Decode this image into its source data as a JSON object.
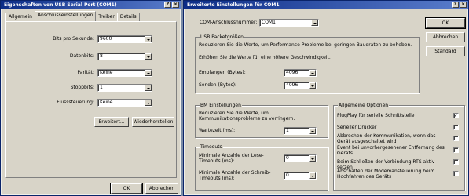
{
  "left_window": {
    "title": "Eigenschaften von USB Serial Port (COM1)",
    "tabs": [
      "Allgemein",
      "Anschlusseinstellungen",
      "Treiber",
      "Details"
    ],
    "fields": [
      {
        "label": "Bits pro Sekunde:",
        "value": "9600"
      },
      {
        "label": "Datenbits:",
        "value": "8"
      },
      {
        "label": "Parität:",
        "value": "Keine"
      },
      {
        "label": "Stoppbits:",
        "value": "1"
      },
      {
        "label": "Flusssteuerung:",
        "value": "Keine"
      }
    ],
    "advanced_button": "Erweitert...",
    "restore_button": "Wiederherstellen",
    "ok_button": "OK",
    "cancel_button": "Abbrechen"
  },
  "right_window": {
    "title": "Erweiterte Einstellungen für COM1",
    "com_label": "COM-Anschlussnummer:",
    "com_value": "COM1",
    "ok_button": "OK",
    "cancel_button": "Abbrechen",
    "standard_button": "Standard",
    "usb_group": {
      "title": "USB Packetgrößen",
      "desc1": "Reduzieren Sie die Werte, um Performance-Probleme bei geringen Baudraten zu beheben.",
      "desc2": "Erhöhen Sie die Werte für eine höhere Geschwindigkeit.",
      "receive_label": "Empfangen (Bytes):",
      "receive_value": "4096",
      "send_label": "Senden (Bytes):",
      "send_value": "4096"
    },
    "bm_group": {
      "title": "BM Einstellungen",
      "desc": "Reduzieren Sie die Werte, um Kommunikationsprobleme zu verringern.",
      "latency_label": "Wartezeit (ms):",
      "latency_value": "1"
    },
    "timeouts_group": {
      "title": "Timeouts",
      "read_label": "Minimale Anzahle der Lese-Timeouts (ms):",
      "read_value": "0",
      "write_label": "Minimale Anzahle der Schreib-Timeouts (ms):",
      "write_value": "0"
    },
    "options_group": {
      "title": "Allgemeine Optionen",
      "items": [
        {
          "label": "PlugPlay für serielle Schnittstelle",
          "checked": "✓"
        },
        {
          "label": "Serieller Drucker",
          "checked": ""
        },
        {
          "label": "Abbrechen der Kommunikation, wenn das Gerät ausgeschaltet wird",
          "checked": ""
        },
        {
          "label": "Event bei unvorhergesehener Entfernung des Geräts",
          "checked": ""
        },
        {
          "label": "Beim Schließen der Verbindung RTS aktiv setzen",
          "checked": ""
        },
        {
          "label": "Abschalten der Modemansteuerung beim Hochfahren des Geräts",
          "checked": ""
        }
      ]
    }
  }
}
